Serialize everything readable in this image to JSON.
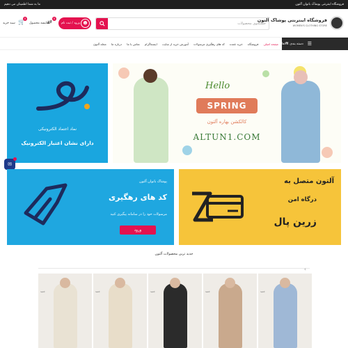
{
  "topbar": {
    "right_text": "فروشگاه اینترنتی پوشاک بانوان آلتون",
    "left_text": "ما به شما اطمینان می دهیم"
  },
  "header": {
    "logo_title": "فروشگاه اینترنتی پوشاک آلتون",
    "logo_subtitle": "WOMEN'S CLOTHING STORE",
    "search_placeholder": "جستجوی محصولات",
    "search_icon": "search-icon",
    "login_label": "ورود / ثبت نام",
    "compare_label": "مقایسه محصول",
    "compare_count": "0",
    "cart_label": "سبد خرید",
    "cart_count": "0"
  },
  "nav": {
    "category_button": "دسته بندی کالاها",
    "items": [
      "صفحه اصلی",
      "فروشگاه",
      "خرید عمده",
      "کد های رهگیری مرسولات",
      "آموزش خرید از سایت",
      "اینستاگرام",
      "تماس با ما",
      "درباره ما",
      "مجله آلتون"
    ]
  },
  "banners": {
    "enamad": {
      "line1": "نماد اعتماد الکترونیکی",
      "line2": "دارای نشان اعتبار الکترونیک"
    },
    "spring": {
      "hello": "Hello",
      "spring": "SPRING",
      "fa": "کالکشن بهاره آلتون",
      "url": "ALTUN1.COM"
    },
    "courier": {
      "line1": "پوشاک بانوان آلتون",
      "line2": "کد های رهگیری",
      "line3": "مرسولات خود را در سامانه پیگیری کنید",
      "button": "ورود"
    },
    "zarinpal": {
      "line1": "آلتون متصل به",
      "line2": "درگاه امن",
      "line3": "زرین پال"
    }
  },
  "products": {
    "title": "جدید ترین محصولات آلتون",
    "items": [
      {
        "tag": "جدید",
        "color": "#e9e2d3"
      },
      {
        "tag": "جدید",
        "color": "#e8ddc9"
      },
      {
        "tag": "جدید",
        "color": "#2b2b2b"
      },
      {
        "tag": "جدید",
        "color": "#c9a98d"
      },
      {
        "tag": "جدید",
        "color": "#9fb8d6"
      }
    ]
  },
  "colors": {
    "accent": "#e4124f",
    "dark": "#2a2a2a",
    "blue_banner": "#1fa7e0",
    "yellow_banner": "#f6c43a"
  }
}
